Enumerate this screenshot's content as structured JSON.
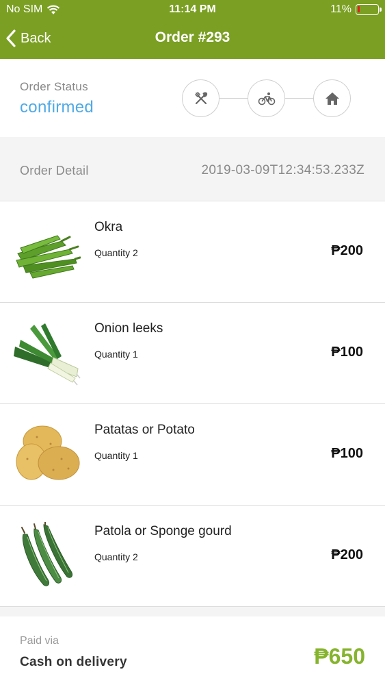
{
  "status_bar": {
    "carrier": "No SIM",
    "time": "11:14 PM",
    "battery_percent": "11%",
    "battery_level": 0.11,
    "battery_color": "#e02020"
  },
  "nav": {
    "back_label": "Back",
    "title": "Order #293",
    "bar_color": "#7a9f22"
  },
  "order_status": {
    "label": "Order Status",
    "value": "confirmed",
    "value_color": "#4ea9e6",
    "steps": [
      {
        "icon": "utensils-icon"
      },
      {
        "icon": "bicycle-icon"
      },
      {
        "icon": "home-icon"
      }
    ]
  },
  "order_detail": {
    "label": "Order Detail",
    "date": "2019-03-09T12:34:53.233Z"
  },
  "items": [
    {
      "name": "Okra",
      "quantity": "Quantity 2",
      "price": "₱200",
      "image": "okra-image"
    },
    {
      "name": "Onion leeks",
      "quantity": "Quantity 1",
      "price": "₱100",
      "image": "leek-image"
    },
    {
      "name": "Patatas or Potato",
      "quantity": "Quantity 1",
      "price": "₱100",
      "image": "potato-image"
    },
    {
      "name": "Patola or Sponge gourd",
      "quantity": "Quantity 2",
      "price": "₱200",
      "image": "sponge-gourd-image"
    }
  ],
  "footer": {
    "paid_label": "Paid via",
    "paid_method": "Cash on delivery",
    "total": "₱650",
    "total_color": "#86b42e"
  }
}
